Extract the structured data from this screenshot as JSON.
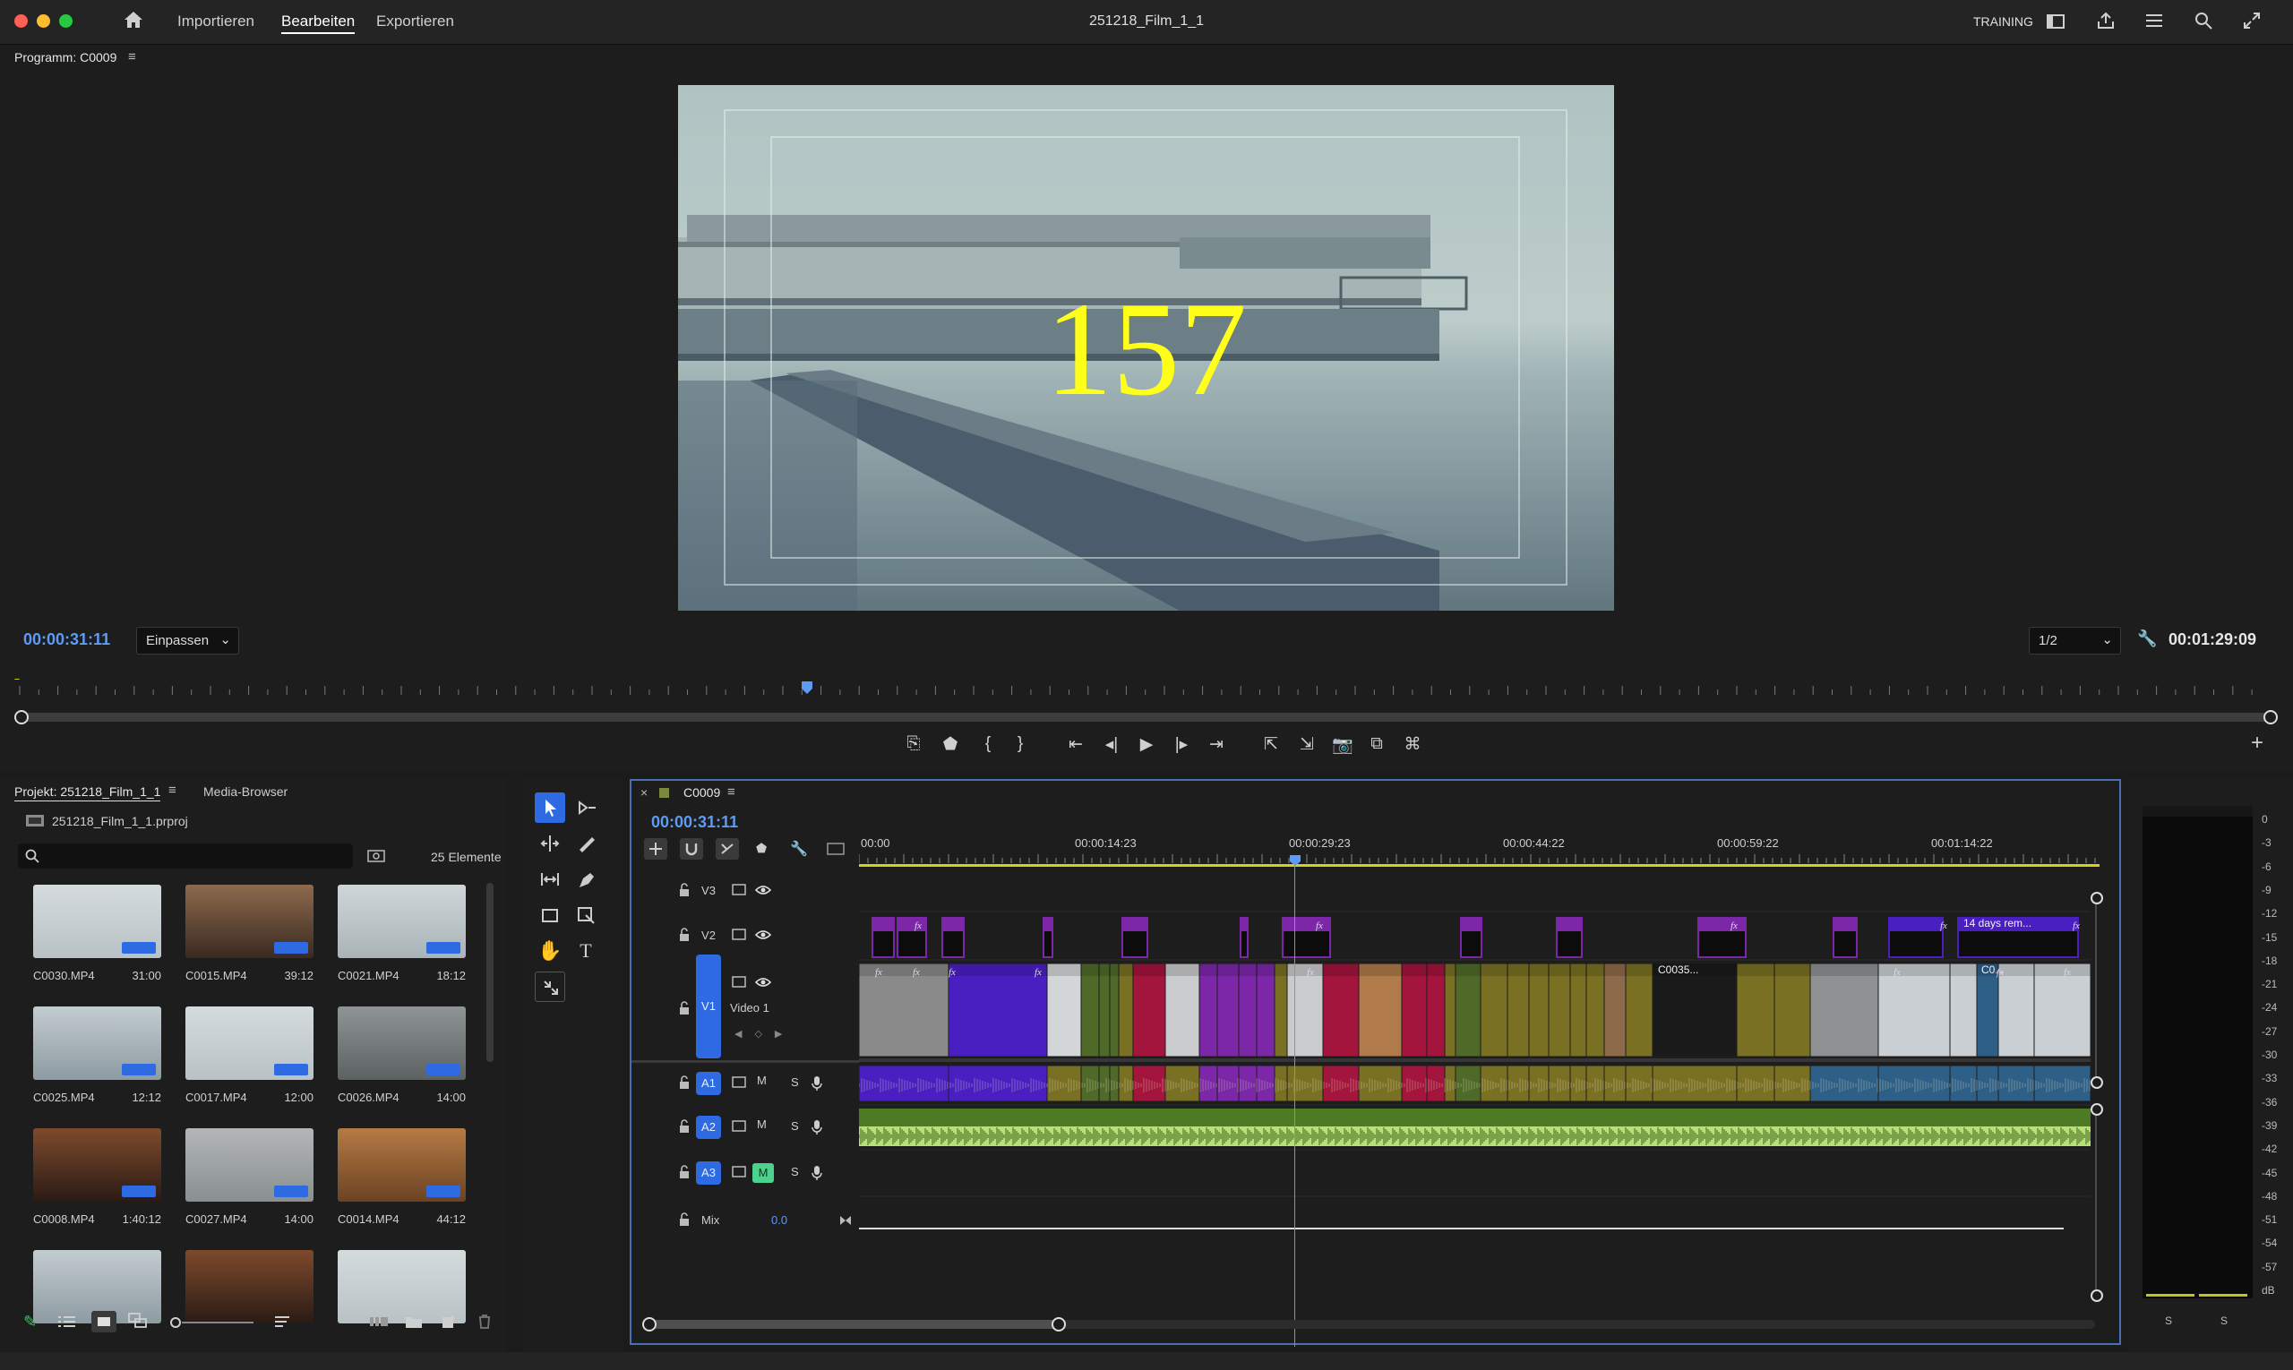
{
  "app": {
    "menu": [
      "Importieren",
      "Bearbeiten",
      "Exportieren"
    ],
    "active_menu": "Bearbeiten",
    "project_title": "251218_Film_1_1",
    "workspace": "TRAINING",
    "icons": [
      "home-icon",
      "panel-layout-icon",
      "share-icon",
      "workspace-menu-icon",
      "search-icon",
      "fullscreen-icon"
    ]
  },
  "program": {
    "panel_title": "Programm: C0009",
    "overlay_number": "157",
    "overlay_color": "#ffff1a",
    "timecode_current": "00:00:31:11",
    "zoom_value": "Einpassen",
    "resolution_value": "1/2",
    "timecode_duration": "00:01:29:09",
    "playhead_fraction": 0.35
  },
  "project": {
    "tab_project": "Projekt: 251218_Film_1_1",
    "tab_media": "Media-Browser",
    "file_name": "251218_Film_1_1.prproj",
    "search_placeholder": "",
    "item_count": "25 Elemente",
    "items": [
      {
        "name": "C0030.MP4",
        "duration": "31:00",
        "tone": "fog"
      },
      {
        "name": "C0015.MP4",
        "duration": "39:12",
        "tone": "face"
      },
      {
        "name": "C0021.MP4",
        "duration": "18:12",
        "tone": "fog2"
      },
      {
        "name": "C0025.MP4",
        "duration": "12:12",
        "tone": "pier"
      },
      {
        "name": "C0017.MP4",
        "duration": "12:00",
        "tone": "fog"
      },
      {
        "name": "C0026.MP4",
        "duration": "14:00",
        "tone": "walk"
      },
      {
        "name": "C0008.MP4",
        "duration": "1:40:12",
        "tone": "room"
      },
      {
        "name": "C0027.MP4",
        "duration": "14:00",
        "tone": "trees"
      },
      {
        "name": "C0014.MP4",
        "duration": "44:12",
        "tone": "wood"
      },
      {
        "name": "",
        "duration": "",
        "tone": "pier"
      },
      {
        "name": "",
        "duration": "",
        "tone": "room"
      },
      {
        "name": "",
        "duration": "",
        "tone": "fog"
      }
    ]
  },
  "timeline": {
    "sequence_name": "C0009",
    "timecode": "00:00:31:11",
    "ruler_labels": [
      "00:00",
      "00:00:14:23",
      "00:00:29:23",
      "00:00:44:22",
      "00:00:59:22",
      "00:01:14:22"
    ],
    "playhead_fraction": 0.365,
    "tracks": [
      {
        "id": "V3",
        "type": "video",
        "name": ""
      },
      {
        "id": "V2",
        "type": "video",
        "name": ""
      },
      {
        "id": "V1",
        "type": "video",
        "name": "Video 1"
      },
      {
        "id": "A1",
        "type": "audio",
        "name": ""
      },
      {
        "id": "A2",
        "type": "audio",
        "name": ""
      },
      {
        "id": "A3",
        "type": "audio",
        "name": ""
      }
    ],
    "mix_label": "Mix",
    "mix_value": "0.0",
    "clip_labels": {
      "c0035": "C0035...",
      "days": "14 days rem...",
      "co": "C0..."
    },
    "btn_m": "M",
    "btn_s": "S"
  },
  "meter": {
    "scale": [
      "0",
      "-3",
      "-6",
      "-9",
      "-12",
      "-15",
      "-18",
      "-21",
      "-24",
      "-27",
      "-30",
      "-33",
      "-36",
      "-39",
      "-42",
      "-45",
      "-48",
      "-51",
      "-54",
      "-57",
      "dB"
    ],
    "channels": [
      "S",
      "S"
    ]
  }
}
